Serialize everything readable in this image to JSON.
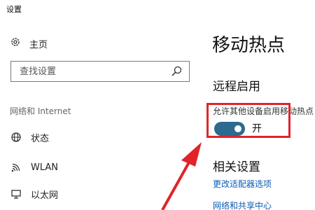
{
  "app": {
    "title": "设置"
  },
  "sidebar": {
    "home_label": "主页",
    "search_placeholder": "查找设置",
    "section_header": "网络和 Internet",
    "items": [
      {
        "label": "状态",
        "icon": "globe-icon"
      },
      {
        "label": "WLAN",
        "icon": "wifi-icon"
      },
      {
        "label": "以太网",
        "icon": "monitor-icon"
      }
    ]
  },
  "main": {
    "page_title": "移动热点",
    "remote_title": "远程启用",
    "remote_description": "允许其他设备启用移动热点",
    "toggle": {
      "state": "on",
      "label": "开"
    },
    "related_title": "相关设置",
    "links": [
      "更改适配器选项",
      "网络和共享中心"
    ]
  },
  "colors": {
    "toggle_on": "#2c6a8f",
    "highlight_border": "#e0242a",
    "arrow": "#e0242a",
    "link": "#0a5db5"
  }
}
